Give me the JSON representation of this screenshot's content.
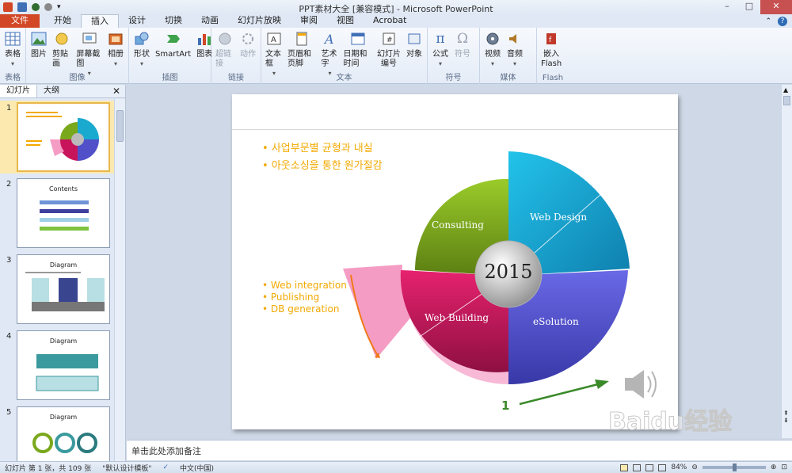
{
  "window": {
    "title": "PPT素材大全 [兼容模式] - Microsoft PowerPoint",
    "controls": [
      "–",
      "□",
      "✕"
    ]
  },
  "tabs": [
    "文件",
    "开始",
    "插入",
    "设计",
    "切换",
    "动画",
    "幻灯片放映",
    "审阅",
    "视图",
    "Acrobat"
  ],
  "active_tab": "插入",
  "ribbon": {
    "groups": [
      {
        "label": "表格",
        "buttons": [
          {
            "label": "表格"
          }
        ]
      },
      {
        "label": "图像",
        "buttons": [
          {
            "label": "图片"
          },
          {
            "label": "剪贴画"
          },
          {
            "label": "屏幕截图"
          },
          {
            "label": "相册"
          }
        ]
      },
      {
        "label": "插图",
        "buttons": [
          {
            "label": "形状"
          },
          {
            "label": "SmartArt"
          },
          {
            "label": "图表"
          }
        ]
      },
      {
        "label": "链接",
        "buttons": [
          {
            "label": "超链接"
          },
          {
            "label": "动作"
          }
        ]
      },
      {
        "label": "文本",
        "buttons": [
          {
            "label": "文本框"
          },
          {
            "label": "页眉和页脚"
          },
          {
            "label": "艺术字"
          },
          {
            "label": "日期和时间"
          },
          {
            "label": "幻灯片\n编号"
          },
          {
            "label": "对象"
          }
        ]
      },
      {
        "label": "符号",
        "buttons": [
          {
            "label": "公式"
          },
          {
            "label": "符号"
          }
        ]
      },
      {
        "label": "媒体",
        "buttons": [
          {
            "label": "视频"
          },
          {
            "label": "音频"
          }
        ]
      },
      {
        "label": "Flash",
        "buttons": [
          {
            "label": "嵌入\nFlash"
          }
        ]
      }
    ]
  },
  "panel": {
    "tabs": [
      "幻灯片",
      "大纲"
    ],
    "thumbnails": [
      {
        "num": "1",
        "title": ""
      },
      {
        "num": "2",
        "title": "Contents"
      },
      {
        "num": "3",
        "title": "Diagram"
      },
      {
        "num": "4",
        "title": "Diagram"
      },
      {
        "num": "5",
        "title": "Diagram"
      }
    ]
  },
  "slide": {
    "bullets_top": [
      "사업부문별 균형과 내실",
      "아웃소싱을 통한 원가절감"
    ],
    "bullets_left": [
      "Web integration",
      "Publishing",
      "DB generation"
    ],
    "center": "2015",
    "segments": [
      "Consulting",
      "Web Design",
      "Web Building",
      "eSolution"
    ],
    "annotation": "1"
  },
  "notes_placeholder": "单击此处添加备注",
  "status": {
    "slide_info": "幻灯片 第 1 张，共 109 张",
    "theme": "\"默认设计模板\"",
    "language": "中文(中国)",
    "zoom": "84%"
  },
  "colors": {
    "accent_orange": "#d24726",
    "bullet_yellow": "#f2a900",
    "consulting_green": "#7aa81c",
    "webdesign_cyan": "#1aa9cf",
    "webbuilding_magenta": "#c8145b",
    "esolution_purple": "#5150c9",
    "pink_wedge": "#f59cc4"
  },
  "watermark_text": "Baidu经验"
}
